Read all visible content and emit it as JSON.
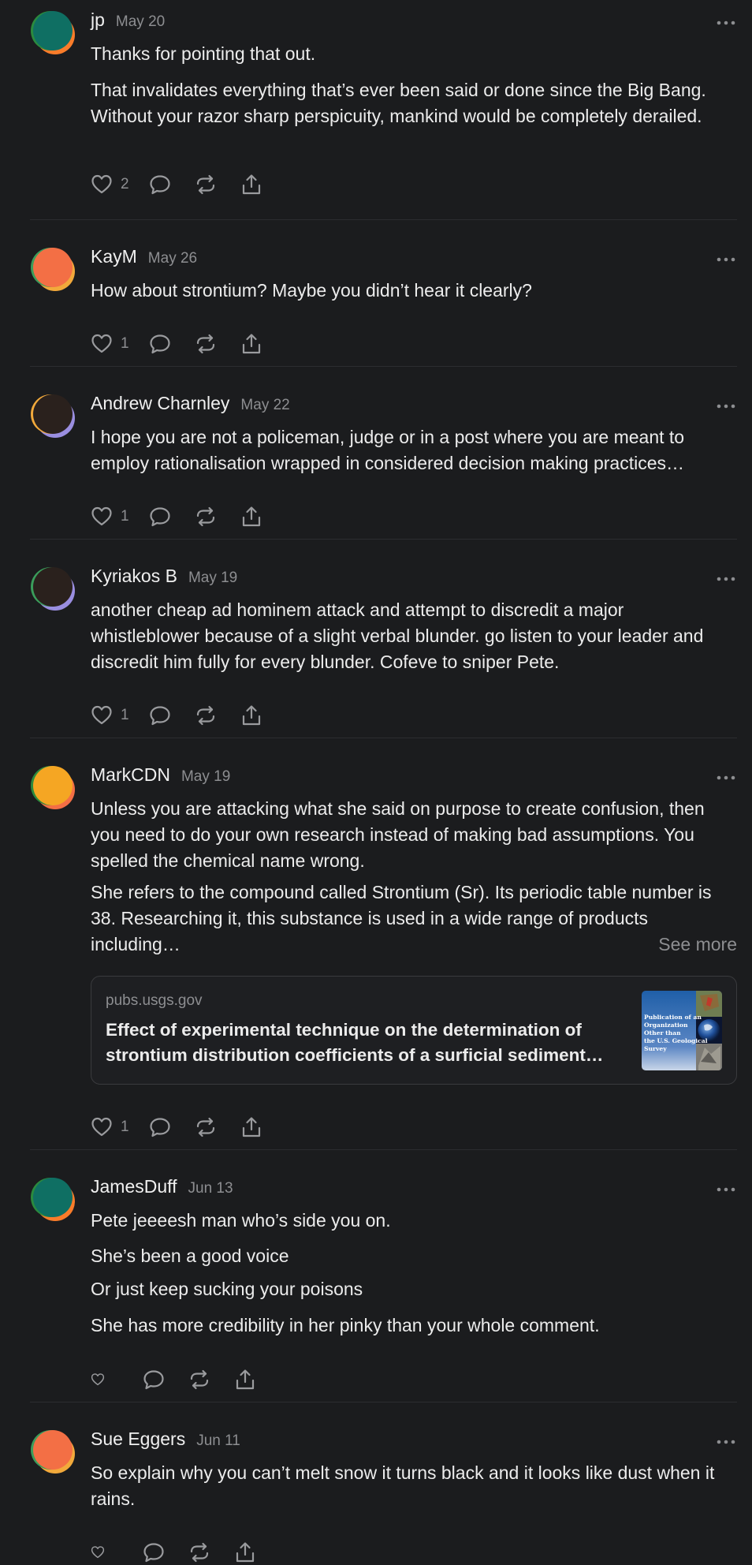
{
  "comments": [
    {
      "author": "jp",
      "date": "May 20",
      "avatar_colors": [
        "#f97c2a",
        "#2b8a3e",
        "#0f6f63"
      ],
      "paragraphs": [
        "Thanks for pointing that out.",
        "That invalidates everything that’s ever been said or done since the Big Bang. Without your razor sharp perspicuity, mankind would be completely derailed."
      ],
      "likes": "2"
    },
    {
      "author": "KayM",
      "date": "May 26",
      "avatar_colors": [
        "#f2a93b",
        "#3a9d5b",
        "#f36f45"
      ],
      "paragraphs": [
        "How about strontium? Maybe you didn’t hear it clearly?"
      ],
      "likes": "1"
    },
    {
      "author": "Andrew Charnley",
      "date": "May 22",
      "avatar_colors": [
        "#9a8ee0",
        "#f2a93b",
        "#2a211d"
      ],
      "paragraphs": [
        "I hope you are not a policeman, judge or in a post where you are meant to employ rationalisation wrapped in considered decision making practices…"
      ],
      "likes": "1"
    },
    {
      "author": "Kyriakos B",
      "date": "May 19",
      "avatar_colors": [
        "#9a8ee0",
        "#3a9d5b",
        "#2a211d"
      ],
      "paragraphs": [
        "another cheap ad hominem attack and attempt to discredit a major whistleblower because of a slight verbal blunder. go listen to your leader and discredit him fully for every blunder. Cofeve to sniper Pete."
      ],
      "likes": "1"
    },
    {
      "author": "MarkCDN",
      "date": "May 19",
      "avatar_colors": [
        "#f36f45",
        "#2b8a3e",
        "#f5a623"
      ],
      "paragraphs": [
        "Unless you are attacking what she said on purpose to create confusion, then you need to do your own research instead of making bad assumptions. You spelled the chemical name wrong.",
        "She refers to the compound called Strontium (Sr). Its periodic table number is 38. Researching it, this substance is used in a wide range of products including…"
      ],
      "see_more": "See more",
      "link": {
        "domain": "pubs.usgs.gov",
        "title": "Effect of experimental technique on the determination of strontium distribution coefficients of a surficial sediment…",
        "thumb_text": [
          "Publication of an",
          "Organization",
          "Other than",
          "the U.S. Geological",
          "Survey"
        ]
      },
      "likes": "1"
    },
    {
      "author": "JamesDuff",
      "date": "Jun 13",
      "avatar_colors": [
        "#f97c2a",
        "#2b8a3e",
        "#0f6f63"
      ],
      "paragraphs": [
        "Pete jeeeesh man who’s side you on.",
        "She’s been a good voice",
        "Or just keep sucking your poisons",
        "She has more credibility in her pinky than your whole comment."
      ],
      "likes": ""
    },
    {
      "author": "Sue Eggers",
      "date": "Jun 11",
      "avatar_colors": [
        "#f2a93b",
        "#3a9d5b",
        "#f36f45"
      ],
      "paragraphs": [
        "So explain why you can’t melt snow it turns black and it looks like dust when it rains."
      ],
      "likes": ""
    }
  ],
  "colors": {
    "background": "#1b1c1e",
    "text": "#ececec",
    "muted": "#8d8e91",
    "divider": "#2c2d30"
  }
}
